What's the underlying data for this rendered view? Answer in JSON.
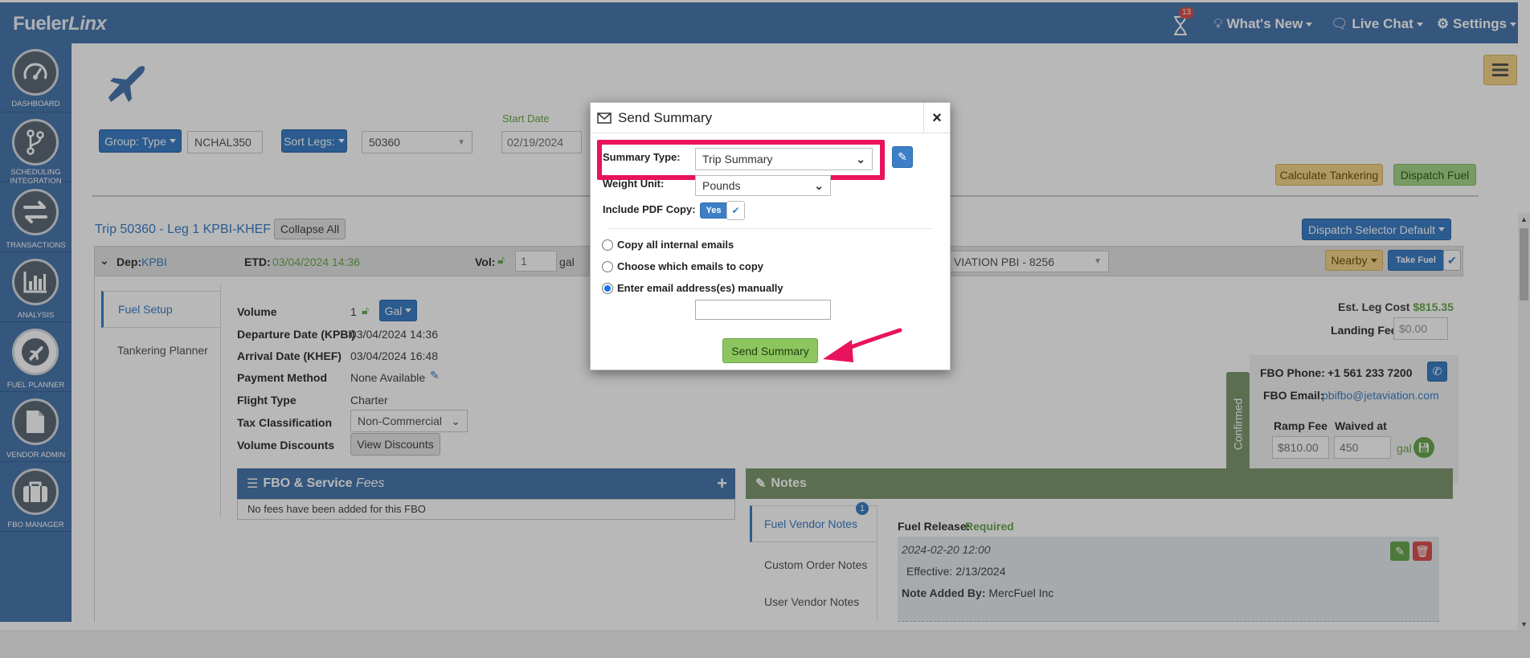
{
  "app": {
    "brand_plain": "Fueler",
    "brand_italic": "Linx",
    "notification_count": "13",
    "nav": {
      "whats_new": "What's New",
      "live_chat": "Live Chat",
      "settings": "Settings"
    }
  },
  "sidebar": {
    "items": [
      {
        "label": "DASHBOARD",
        "icon": "dashboard-icon"
      },
      {
        "label": "SCHEDULING INTEGRATION",
        "icon": "scheduling-icon"
      },
      {
        "label": "TRANSACTIONS",
        "icon": "transactions-icon"
      },
      {
        "label": "ANALYSIS",
        "icon": "analysis-icon"
      },
      {
        "label": "FUEL PLANNER",
        "icon": "fuel-planner-icon"
      },
      {
        "label": "VENDOR ADMIN",
        "icon": "vendor-admin-icon"
      },
      {
        "label": "FBO MANAGER",
        "icon": "fbo-manager-icon"
      }
    ]
  },
  "filters": {
    "group_type": "Group: Type",
    "tail_value": "NCHAL350",
    "sort_legs": "Sort Legs:",
    "trip_value": "50360",
    "start_date_label": "Start Date",
    "start_date_value": "02/19/2024"
  },
  "actions": {
    "calculate_tankering": "Calculate Tankering",
    "dispatch_fuel": "Dispatch Fuel",
    "dispatch_selector": "Dispatch Selector Default"
  },
  "trip": {
    "title": "Trip 50360 - Leg 1 KPBI-KHEF",
    "collapse_all": "Collapse All",
    "dep_label": "Dep:",
    "dep_value": "KPBI",
    "etd_label": "ETD:",
    "etd_value": "03/04/2024 14:36",
    "vol_label": "Vol:",
    "vol_value": "1",
    "vol_unit": "gal",
    "fbo_select": "VIATION PBI - 8256",
    "nearby": "Nearby",
    "take_fuel": "Take Fuel"
  },
  "tabs": {
    "fuel_setup": "Fuel Setup",
    "tankering_planner": "Tankering Planner"
  },
  "details": {
    "volume_label": "Volume",
    "volume_value": "1",
    "volume_unit": "Gal",
    "departure_label": "Departure Date (KPBI)",
    "departure_value": "03/04/2024 14:36",
    "arrival_label": "Arrival Date (KHEF)",
    "arrival_value": "03/04/2024 16:48",
    "payment_label": "Payment Method",
    "payment_value": "None Available",
    "flight_type_label": "Flight Type",
    "flight_type_value": "Charter",
    "tax_label": "Tax Classification",
    "tax_value": "Non-Commercial",
    "discounts_label": "Volume Discounts",
    "view_discounts": "View Discounts"
  },
  "costs": {
    "est_leg_cost_label": "Est. Leg Cost",
    "est_leg_cost_value": "$815.35",
    "landing_fee_label": "Landing Fee",
    "landing_fee_placeholder": "$0.00",
    "confirmed": "Confirmed",
    "fbo_phone_label": "FBO Phone:",
    "fbo_phone_value": "+1 561 233 7200",
    "fbo_email_label": "FBO Email:",
    "fbo_email_value": "pbifbo@jetaviation.com",
    "ramp_fee_label": "Ramp Fee",
    "ramp_fee_value": "$810.00",
    "waived_label": "Waived at",
    "waived_value": "450",
    "waived_unit": "gal"
  },
  "fbo_fees": {
    "title_bold": "FBO & Service",
    "title_italic": "Fees",
    "empty_text": "No fees have been added for this FBO"
  },
  "notes": {
    "title": "Notes",
    "tabs": [
      {
        "label": "Fuel Vendor Notes",
        "badge": "1"
      },
      {
        "label": "Custom Order Notes",
        "badge": ""
      },
      {
        "label": "User Vendor Notes",
        "badge": ""
      }
    ],
    "fuel_release_label": "Fuel Release:",
    "fuel_release_value": "Required",
    "note_date": "2024-02-20 12:00",
    "note_effective": "Effective: 2/13/2024",
    "note_added_by_label": "Note Added By:",
    "note_added_by_value": "MercFuel Inc"
  },
  "modal": {
    "title": "Send Summary",
    "close": "×",
    "summary_type_label": "Summary Type:",
    "summary_type_value": "Trip Summary",
    "weight_unit_label": "Weight Unit:",
    "weight_unit_value": "Pounds",
    "include_pdf_label": "Include PDF Copy:",
    "include_pdf_toggle": "Yes",
    "radio_options": [
      {
        "label": "Copy all internal emails",
        "checked": false
      },
      {
        "label": "Choose which emails to copy",
        "checked": false
      },
      {
        "label": "Enter email address(es) manually",
        "checked": true
      }
    ],
    "email_input_value": "",
    "send_button": "Send Summary"
  },
  "colors": {
    "brand_blue": "#4a78ae",
    "highlight_pink": "#e8135d",
    "notes_green": "#7e9a70",
    "link_blue": "#3c7fc7",
    "success_green": "#6aa84f"
  }
}
